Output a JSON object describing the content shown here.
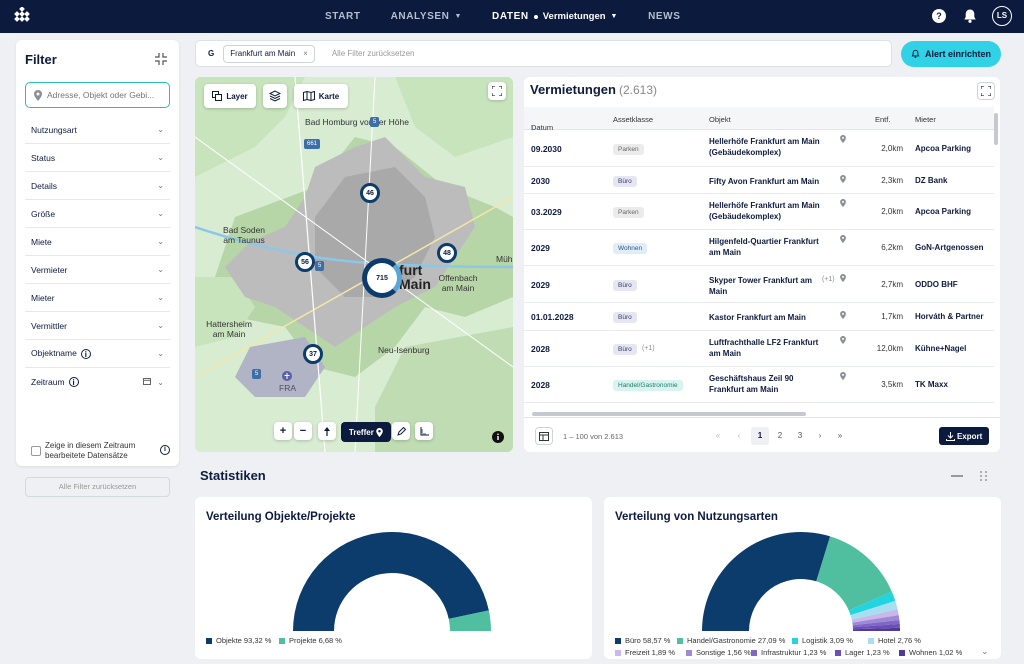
{
  "nav": {
    "items": [
      {
        "label": "START",
        "active": false
      },
      {
        "label": "ANALYSEN",
        "active": false,
        "dropdown": true
      },
      {
        "label": "DATEN",
        "active": true,
        "sub": "Vermietungen",
        "dropdown": true
      },
      {
        "label": "NEWS",
        "active": false
      }
    ],
    "help": "?",
    "avatar": "LS"
  },
  "filter": {
    "title": "Filter",
    "search_placeholder": "Adresse, Objekt oder Gebi...",
    "rows": [
      "Nutzungsart",
      "Status",
      "Details",
      "Größe",
      "Miete",
      "Vermieter",
      "Mieter",
      "Vermittler",
      "Objektname",
      "Zeitraum"
    ],
    "checkbox_label": "Zeige in diesem Zeitraum bearbeitete Datensätze",
    "reset": "Alle Filter zurücksetzen"
  },
  "chips": {
    "prefix": "G",
    "active": "Frankfurt am Main",
    "clear": "Alle Filter zurücksetzen"
  },
  "alert_button": "Alert einrichten",
  "map": {
    "layer": "Layer",
    "karte": "Karte",
    "treffer": "Treffer",
    "clusters": [
      "715",
      "46",
      "56",
      "48",
      "37"
    ],
    "labels": {
      "homburg": "Bad Homburg vor der Höhe",
      "soden": "Bad Soden am Taunus",
      "offenbach": "Offenbach am Main",
      "hattersheim": "Hattersheim am Main",
      "neuisenburg": "Neu-Isenburg",
      "fra": "FRA",
      "muh": "Müh",
      "city1": "furt",
      "city2": "Main",
      "r661": "661",
      "r5a": "5",
      "r5b": "5",
      "r5c": "5"
    }
  },
  "vermietungen": {
    "title": "Vermietungen",
    "count": "(2.613)",
    "columns": [
      "Datum",
      "Assetklasse",
      "Objekt",
      "Entf.",
      "Mieter"
    ],
    "rows": [
      {
        "datum": "09.2030",
        "asset": "Parken",
        "cls": "parken",
        "plus": "",
        "objekt": "Hellerhöfe Frankfurt am Main (Gebäudekomplex)",
        "entf": "2,0km",
        "mieter": "Apcoa Parking"
      },
      {
        "datum": "2030",
        "asset": "Büro",
        "cls": "buro",
        "plus": "",
        "objekt": "Fifty Avon Frankfurt am Main",
        "entf": "2,3km",
        "mieter": "DZ Bank"
      },
      {
        "datum": "03.2029",
        "asset": "Parken",
        "cls": "parken",
        "plus": "",
        "objekt": "Hellerhöfe Frankfurt am Main (Gebäudekomplex)",
        "entf": "2,0km",
        "mieter": "Apcoa Parking"
      },
      {
        "datum": "2029",
        "asset": "Wohnen",
        "cls": "wohnen",
        "plus": "",
        "objekt": "Hilgenfeld-Quartier Frankfurt am Main",
        "entf": "6,2km",
        "mieter": "GoN-Artgenossen"
      },
      {
        "datum": "2029",
        "asset": "Büro",
        "cls": "buro",
        "plus": "",
        "objekt": "Skyper Tower Frankfurt am Main",
        "objplus": "(+1)",
        "entf": "2,7km",
        "mieter": "ODDO BHF"
      },
      {
        "datum": "01.01.2028",
        "asset": "Büro",
        "cls": "buro",
        "plus": "",
        "objekt": "Kastor Frankfurt am Main",
        "entf": "1,7km",
        "mieter": "Horváth & Partner"
      },
      {
        "datum": "2028",
        "asset": "Büro",
        "cls": "buro",
        "plus": "(+1)",
        "objekt": "Luftfrachthalle LF2 Frankfurt am Main",
        "entf": "12,0km",
        "mieter": "Kühne+Nagel"
      },
      {
        "datum": "2028",
        "asset": "Handel/Gastronomie",
        "cls": "handel",
        "plus": "",
        "objekt": "Geschäftshaus Zeil 90 Frankfurt am Main",
        "entf": "3,5km",
        "mieter": "TK Maxx"
      }
    ],
    "range": "1 – 100 von 2.613",
    "pages": [
      "1",
      "2",
      "3"
    ],
    "export": "Export"
  },
  "statistiken": {
    "title": "Statistiken"
  },
  "chart_data": [
    {
      "type": "pie",
      "title": "Verteilung Objekte/Projekte",
      "categories": [
        "Objekte",
        "Projekte"
      ],
      "values": [
        93.32,
        6.68
      ],
      "labels": [
        "Objekte 93,32 %",
        "Projekte 6,68 %"
      ],
      "colors": [
        "#0b3c6b",
        "#4fbf9f"
      ],
      "legend": "bottom-left"
    },
    {
      "type": "pie",
      "title": "Verteilung von Nutzungsarten",
      "categories": [
        "Büro",
        "Handel/Gastronomie",
        "Logistik",
        "Hotel",
        "Freizeit",
        "Sonstige",
        "Infrastruktur",
        "Lager",
        "Wohnen"
      ],
      "values": [
        58.57,
        27.09,
        3.09,
        2.76,
        1.89,
        1.56,
        1.23,
        1.23,
        1.02
      ],
      "labels": [
        "Büro 58,57 %",
        "Handel/Gastronomie 27,09 %",
        "Logistik 3,09 %",
        "Hotel 2,76 %",
        "Freizeit 1,89 %",
        "Sonstige 1,56 %",
        "Infrastruktur 1,23 %",
        "Lager 1,23 %",
        "Wohnen 1,02 %"
      ],
      "colors": [
        "#0b3c6b",
        "#4fbf9f",
        "#22d3e0",
        "#a6dff2",
        "#c9b8ea",
        "#9f89d6",
        "#7f66c7",
        "#6a4fb8",
        "#4e3a9a"
      ],
      "legend": "bottom-left"
    }
  ]
}
